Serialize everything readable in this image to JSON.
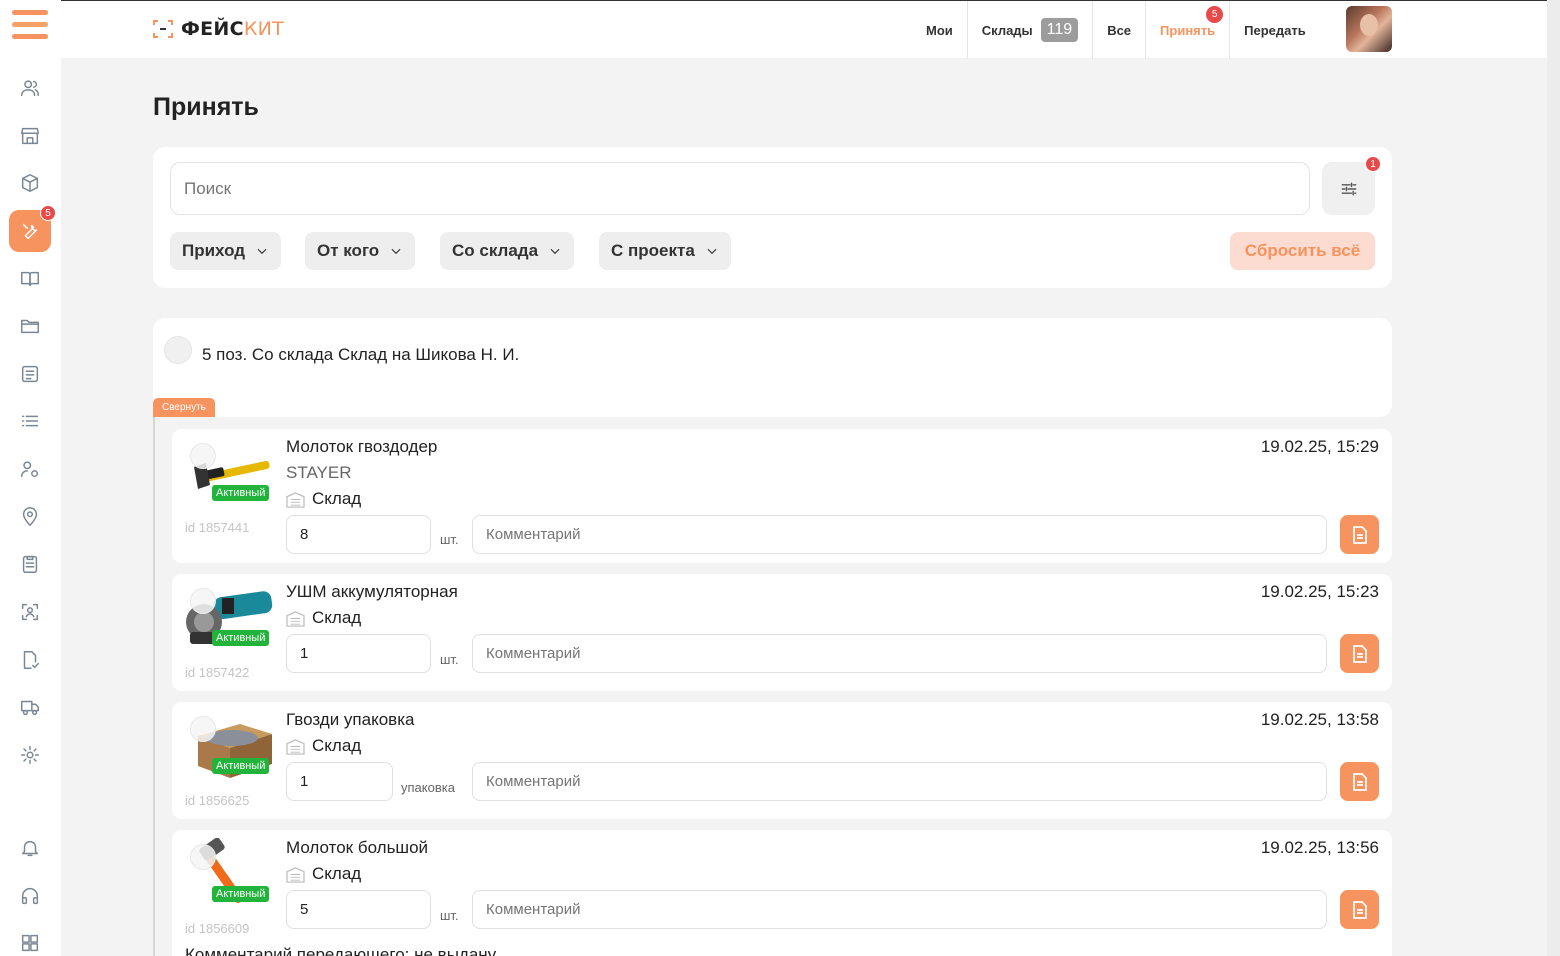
{
  "app": {
    "logo_prefix": "ФЕЙС",
    "logo_accent": "КИТ",
    "brand_color": "#f7935e"
  },
  "sidebar": {
    "active_badge": "5",
    "icons": [
      "users-icon",
      "shop-icon",
      "box-icon",
      "tools-icon",
      "book-icon",
      "folder-icon",
      "list-box-icon",
      "list-icon",
      "user-settings-icon",
      "location-pin-icon",
      "clipboard-icon",
      "face-scan-icon",
      "file-check-icon",
      "truck-icon",
      "gear-icon",
      "bell-icon",
      "headset-icon",
      "grid-icon"
    ]
  },
  "nav": {
    "mine": "Мои",
    "warehouses": "Склады",
    "warehouses_count": "119",
    "all": "Все",
    "accept": "Принять",
    "accept_badge": "5",
    "transfer": "Передать"
  },
  "page": {
    "title": "Принять"
  },
  "filters": {
    "search_placeholder": "Поиск",
    "settings_badge": "1",
    "chips": [
      "Приход",
      "От кого",
      "Со склада",
      "С проекта"
    ],
    "reset_label": "Сбросить всё"
  },
  "group": {
    "title": "5 поз. Со склада Склад  на Шикова Н. И.",
    "collapse_label": "Свернуть"
  },
  "items": [
    {
      "name": "Молоток гвоздодер",
      "brand": "STAYER",
      "warehouse": "Склад",
      "status": "Активный",
      "id": "id 1857441",
      "date": "19.02.25, 15:29",
      "qty": "8",
      "unit": "шт.",
      "comment_placeholder": "Комментарий"
    },
    {
      "name": "УШМ аккумуляторная",
      "warehouse": "Склад",
      "status": "Активный",
      "id": "id 1857422",
      "date": "19.02.25, 15:23",
      "qty": "1",
      "unit": "шт.",
      "comment_placeholder": "Комментарий"
    },
    {
      "name": "Гвозди упаковка",
      "warehouse": "Склад",
      "status": "Активный",
      "id": "id 1856625",
      "date": "19.02.25, 13:58",
      "qty": "1",
      "unit": "упаковка",
      "comment_placeholder": "Комментарий"
    },
    {
      "name": "Молоток большой",
      "warehouse": "Склад",
      "status": "Активный",
      "id": "id 1856609",
      "date": "19.02.25, 13:56",
      "qty": "5",
      "unit": "шт.",
      "comment_placeholder": "Комментарий",
      "sender_comment": "Комментарий передающего: не выдану"
    }
  ]
}
